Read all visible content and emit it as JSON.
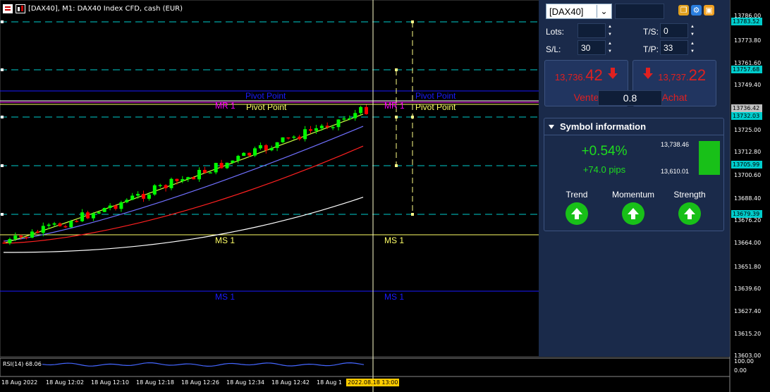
{
  "window": {
    "title": "[DAX40], M1:  DAX40 Index CFD, cash (EUR)"
  },
  "panel": {
    "symbol": "[DAX40]",
    "lots_label": "Lots:",
    "lots_value": "",
    "ts_label": "T/S:",
    "ts_value": "0",
    "sl_label": "S/L:",
    "sl_value": "30",
    "tp_label": "T/P:",
    "tp_value": "33",
    "sell": {
      "price_small": "13,736.",
      "price_big": "42",
      "label": "Vente"
    },
    "buy": {
      "price_small": "13,737.",
      "price_big": "22",
      "label": "Achat"
    },
    "lot_size": "0.8",
    "symbol_info": {
      "header": "Symbol information",
      "change_pct": "+0.54%",
      "change_pips": "+74.0 pips",
      "range_high": "13,738.46",
      "range_low": "13,610.01",
      "indicators": [
        {
          "label": "Trend",
          "icon": "up-arrow-icon"
        },
        {
          "label": "Momentum",
          "icon": "up-arrow-icon"
        },
        {
          "label": "Strength",
          "icon": "up-arrow-icon"
        }
      ]
    }
  },
  "price_axis": {
    "ticks": [
      "13786.00",
      "13773.80",
      "13761.60",
      "13749.40",
      "13725.00",
      "13712.80",
      "13700.60",
      "13688.40",
      "13676.20",
      "13664.00",
      "13651.80",
      "13639.60",
      "13627.40",
      "13615.20",
      "13603.00"
    ],
    "tags": [
      {
        "text": "13783.52",
        "color": "#00cccc"
      },
      {
        "text": "13757.68",
        "color": "#00cccc"
      },
      {
        "text": "13736.42",
        "color": "#c0c0c0"
      },
      {
        "text": "13732.03",
        "color": "#00cccc"
      },
      {
        "text": "13705.99",
        "color": "#00cccc"
      },
      {
        "text": "13679.39",
        "color": "#00cccc"
      }
    ]
  },
  "time_axis": {
    "ticks": [
      "18 Aug 2022",
      "18 Aug 12:02",
      "18 Aug 12:10",
      "18 Aug 12:18",
      "18 Aug 12:26",
      "18 Aug 12:34",
      "18 Aug 12:42",
      "18 Aug 1"
    ],
    "cursor_tag": "2022.08.18 13:00"
  },
  "levels": {
    "pivot": "Pivot Point",
    "mr1": "MR 1",
    "ms1": "MS 1"
  },
  "rsi": {
    "label": "RSI(14) 68.06",
    "ticks": [
      "100.00",
      "0.00"
    ]
  },
  "colors": {
    "bull": "#00ff00",
    "bear": "#ff0000",
    "cyan_level": "#00cccc",
    "pivot_blue": "#1a1aff",
    "ms1_yellow": "#ffff66",
    "mr1_magenta": "#ff00ff",
    "panel_bg": "#1a2a4a"
  }
}
